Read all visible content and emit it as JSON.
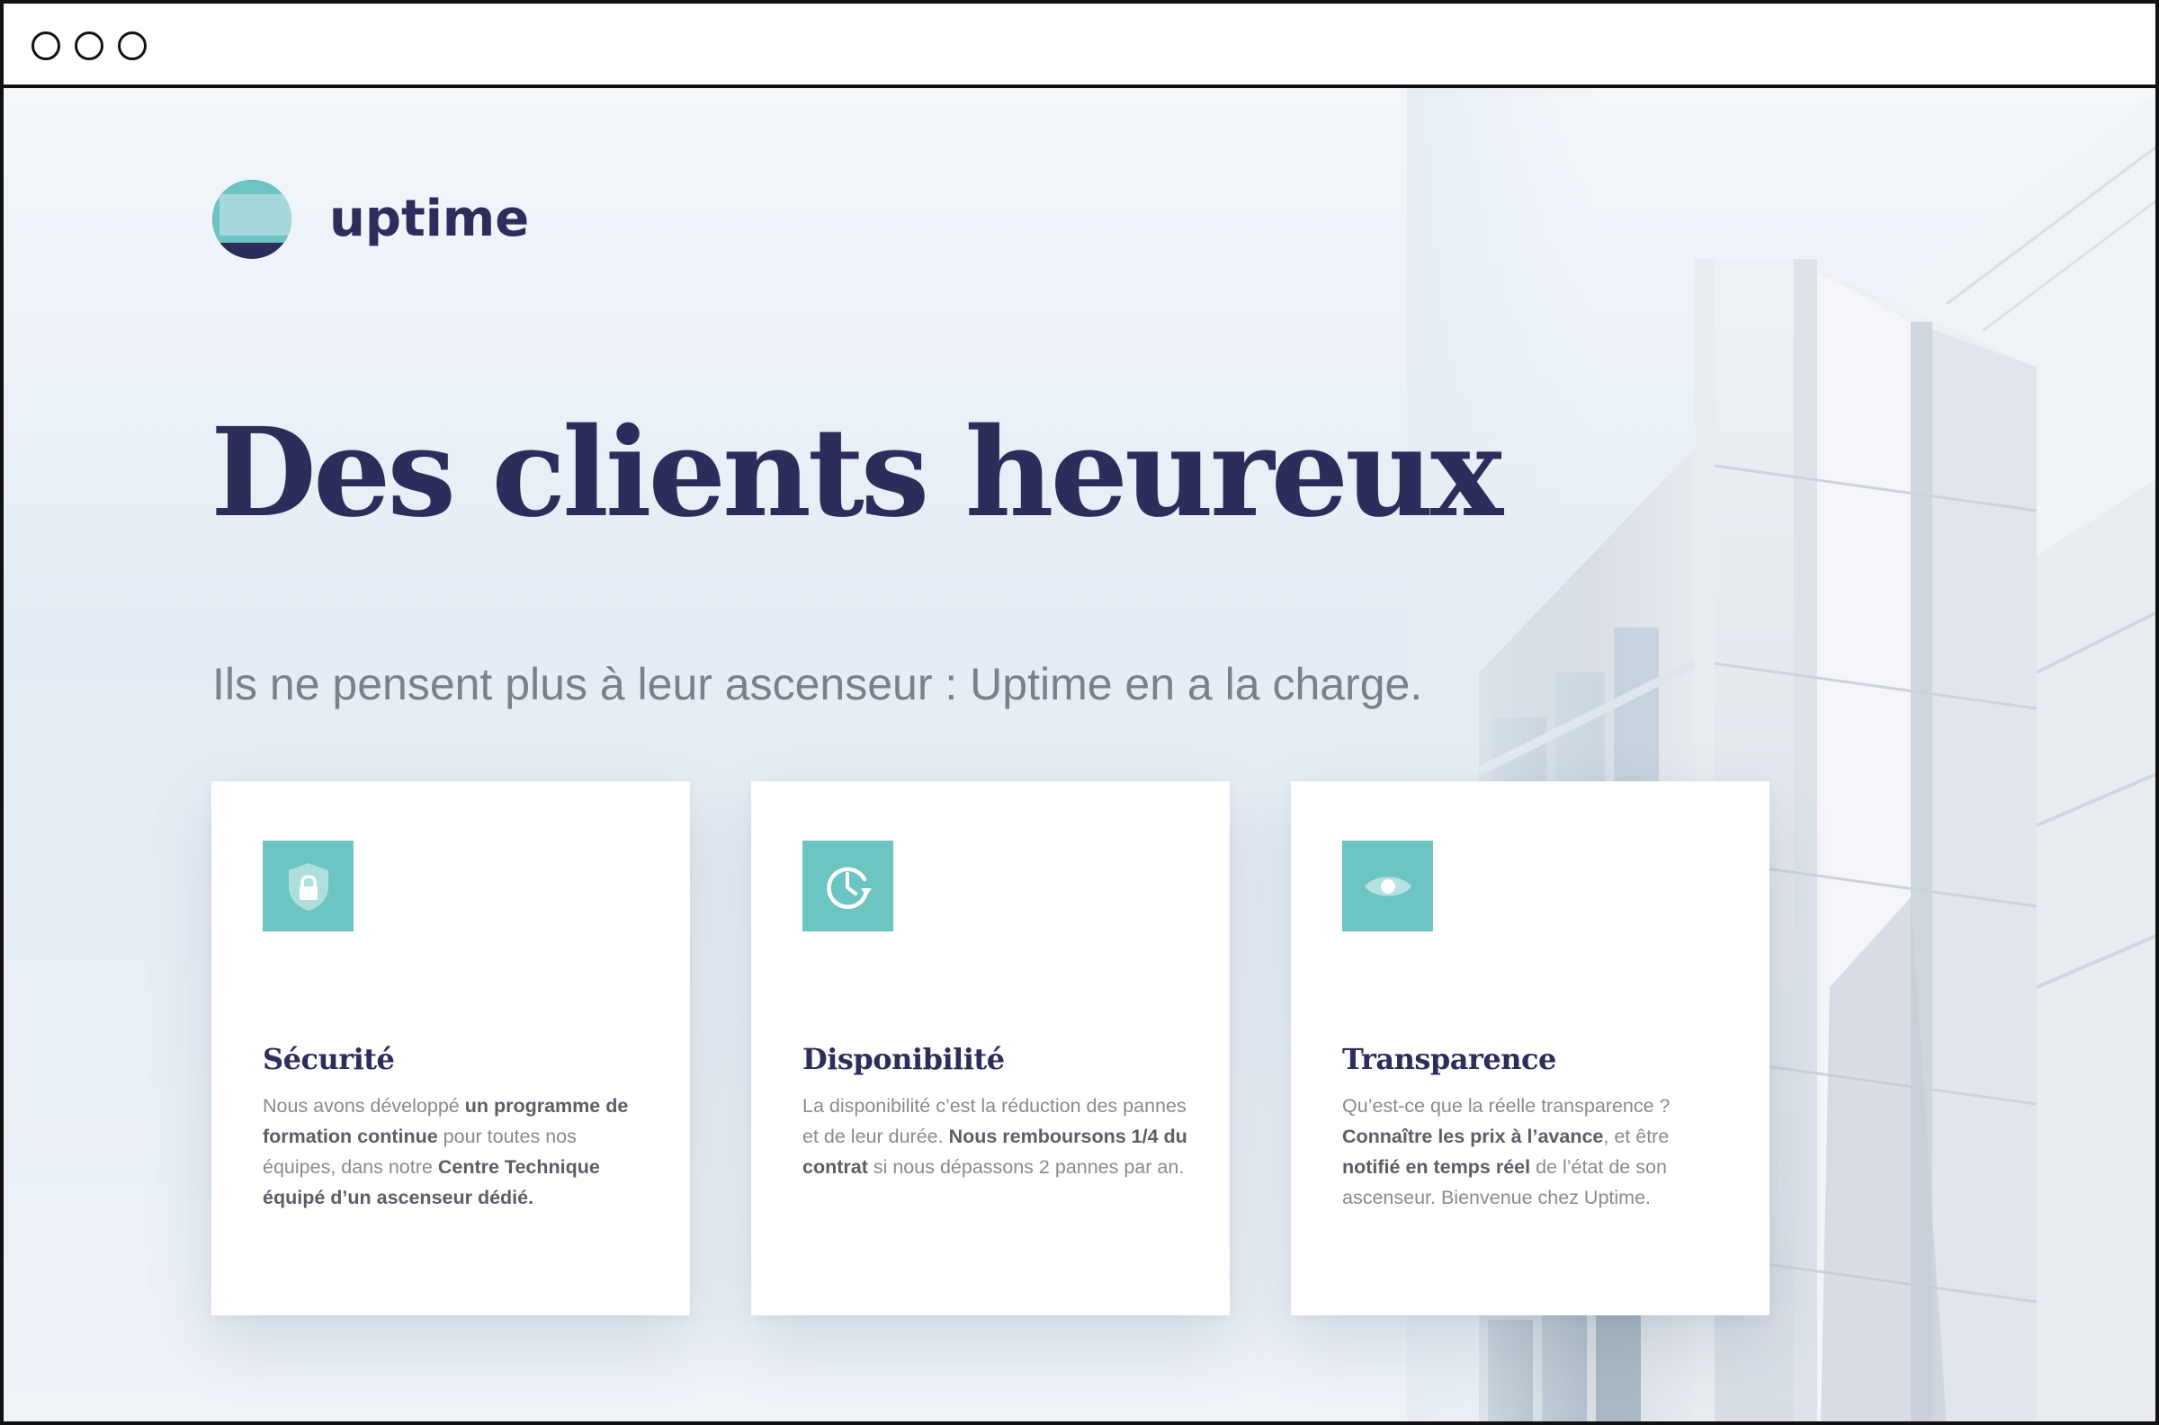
{
  "window": {
    "buttons": [
      "close",
      "minimize",
      "maximize"
    ]
  },
  "brand": {
    "name": "uptime",
    "logo_icon": "uptime-logo-icon",
    "colors": {
      "navy": "#2c2d5b",
      "teal": "#6cc5c2",
      "light_teal": "#a7d6dd",
      "muted_text": "#868a93"
    }
  },
  "hero": {
    "title": "Des clients heureux",
    "subtitle": "Ils ne pensent plus à leur ascenseur : Uptime en a la charge."
  },
  "cards": [
    {
      "icon": "shield-lock-icon",
      "title": "Sécurité",
      "text_parts": [
        {
          "text": "Nous avons développé ",
          "bold": false
        },
        {
          "text": "un programme de formation continue",
          "bold": true
        },
        {
          "text": " pour toutes nos équipes, dans notre ",
          "bold": false
        },
        {
          "text": "Centre Technique équipé d’un ascenseur dédié.",
          "bold": true
        }
      ]
    },
    {
      "icon": "clock-refresh-icon",
      "title": "Disponibilité",
      "text_parts": [
        {
          "text": "La disponibilité c’est la réduction des pannes et de leur durée. ",
          "bold": false
        },
        {
          "text": "Nous remboursons 1/4 du contrat",
          "bold": true
        },
        {
          "text": " si nous dépassons 2 pannes par an.",
          "bold": false
        }
      ]
    },
    {
      "icon": "eye-icon",
      "title": "Transparence",
      "text_parts": [
        {
          "text": "Qu’est-ce que la réelle transparence ? ",
          "bold": false
        },
        {
          "text": "Connaître les prix à l’avance",
          "bold": true
        },
        {
          "text": ", et être ",
          "bold": false
        },
        {
          "text": "notifié en temps réel",
          "bold": true
        },
        {
          "text": " de l’état de son ascenseur. Bienvenue chez Uptime.",
          "bold": false
        }
      ]
    }
  ]
}
